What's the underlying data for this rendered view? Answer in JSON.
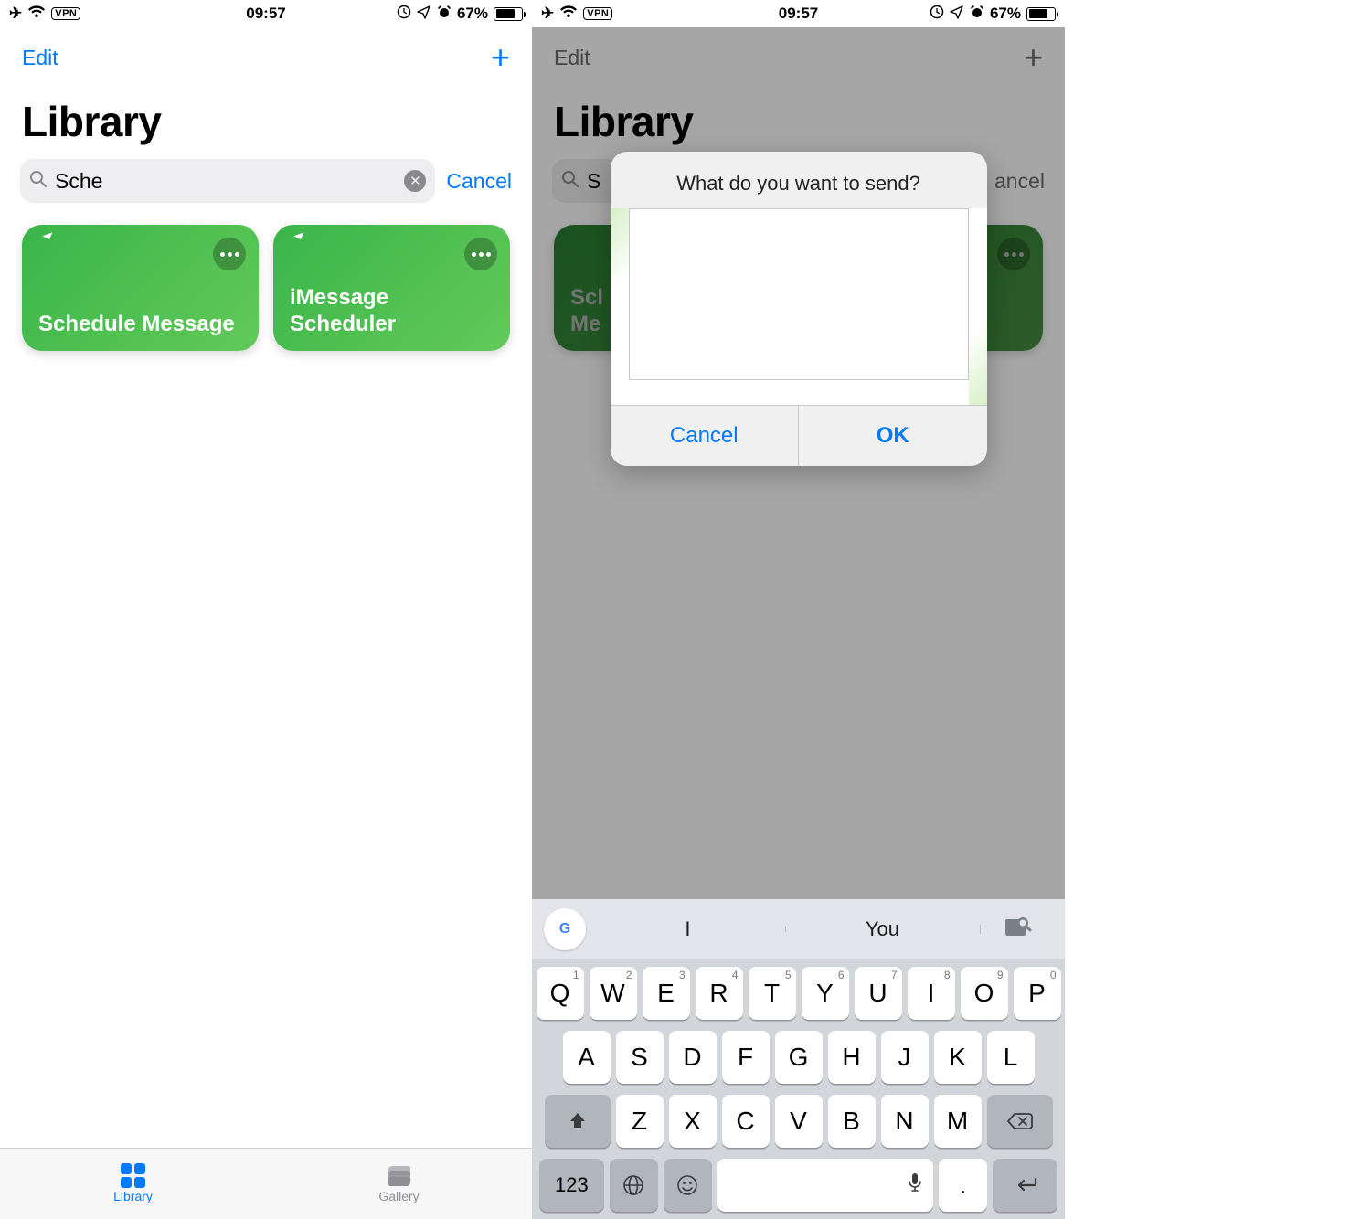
{
  "status": {
    "time": "09:57",
    "battery_pct": "67%",
    "vpn": "VPN"
  },
  "left": {
    "edit": "Edit",
    "title": "Library",
    "search_value": "Sche",
    "cancel": "Cancel",
    "cards": [
      {
        "title": "Schedule Message"
      },
      {
        "title": "iMessage Scheduler"
      }
    ],
    "tabs": {
      "library": "Library",
      "gallery": "Gallery"
    }
  },
  "right": {
    "edit": "Edit",
    "title": "Library",
    "search_value": "S",
    "cancel": "ancel",
    "card0_top": "Scl",
    "card0_bot": "Me",
    "alert": {
      "prompt": "What do you want to send?",
      "cancel": "Cancel",
      "ok": "OK"
    },
    "suggestions": [
      "I",
      "You"
    ],
    "keys": {
      "row1": [
        "Q",
        "W",
        "E",
        "R",
        "T",
        "Y",
        "U",
        "I",
        "O",
        "P"
      ],
      "row1sup": [
        "1",
        "2",
        "3",
        "4",
        "5",
        "6",
        "7",
        "8",
        "9",
        "0"
      ],
      "row2": [
        "A",
        "S",
        "D",
        "F",
        "G",
        "H",
        "J",
        "K",
        "L"
      ],
      "row3": [
        "Z",
        "X",
        "C",
        "V",
        "B",
        "N",
        "M"
      ],
      "numkey": "123",
      "period": "."
    }
  }
}
